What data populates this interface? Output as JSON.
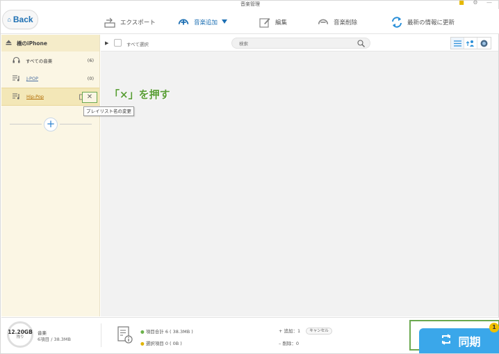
{
  "window": {
    "title": "音楽管理"
  },
  "toolbar": {
    "back_label": "Back",
    "export_label": "エクスポート",
    "add_music_label": "音楽追加",
    "edit_label": "編集",
    "delete_label": "音楽削除",
    "refresh_label": "最新の情報に更新"
  },
  "sidebar": {
    "device_name": "橋のiPhone",
    "items": [
      {
        "label": "すべての音楽",
        "count": "(6)"
      },
      {
        "label": "J-POP",
        "count": "(0)"
      },
      {
        "label": "Hip-Pop",
        "count": ""
      }
    ],
    "tooltip": "プレイリスト名の変更",
    "annotation": "「×」を押す"
  },
  "list": {
    "select_all_label": "すべて選択",
    "search_placeholder": "検索"
  },
  "status": {
    "storage_size": "12.20GB",
    "storage_sub": "残り",
    "storage_title": "音楽",
    "storage_detail": "6項目 / 38.3MB",
    "total_items": "項目合計 6 ( 38.3MB )",
    "selected_items": "選択項目 0 ( 0B )",
    "added": "追加：1",
    "deleted": "削除：0",
    "cancel_label": "キャンセル",
    "sync_label": "同期",
    "sync_badge": "1"
  },
  "colors": {
    "accent_blue": "#1c6fb3",
    "sync_blue": "#3aa7ea",
    "sidebar_bg": "#fbf6e4",
    "annotation_green": "#5a9e37"
  }
}
